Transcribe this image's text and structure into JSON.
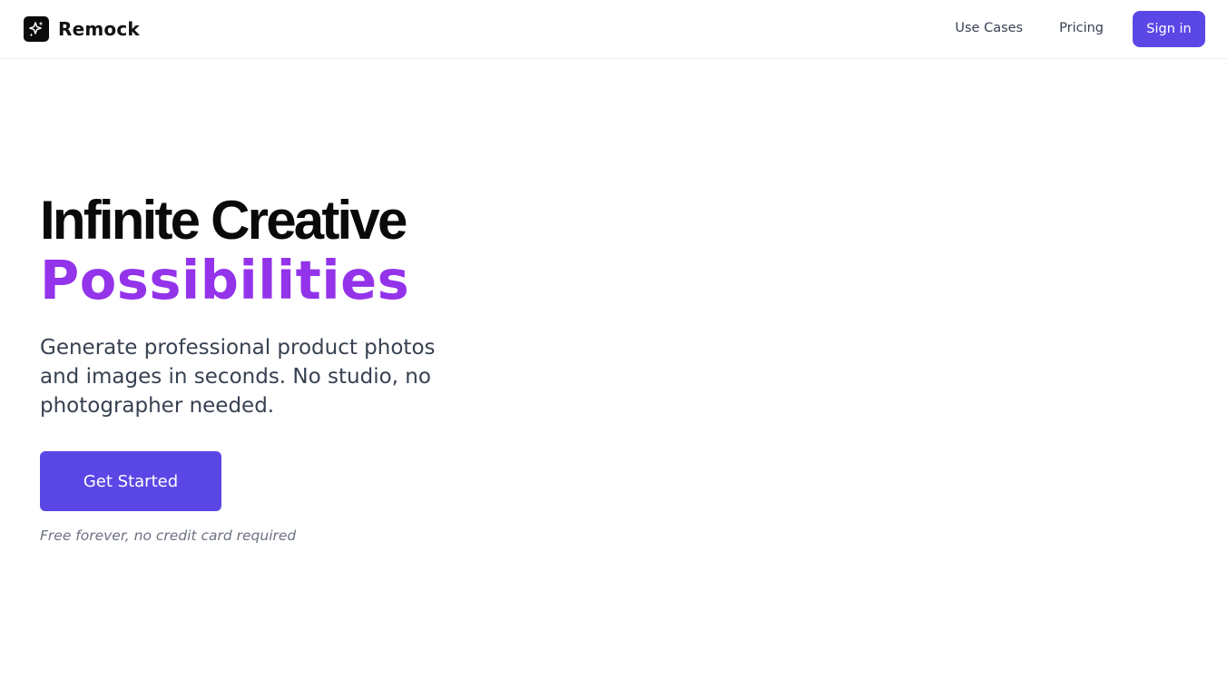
{
  "header": {
    "brand_name": "Remock",
    "brand_icon": "sparkles-icon",
    "nav": {
      "use_cases_label": "Use Cases",
      "pricing_label": "Pricing",
      "sign_in_label": "Sign in"
    }
  },
  "hero": {
    "title_line1": "Infinite Creative",
    "title_line2": "Possibilities",
    "subtitle": "Generate professional product photos and images in seconds. No studio, no photographer needed.",
    "cta_label": "Get Started",
    "cta_note": "Free forever, no credit card required"
  },
  "colors": {
    "accent": "#5b47e5",
    "highlight": "#9333ea",
    "text_primary": "#0a0a0a",
    "text_secondary": "#374151",
    "text_muted": "#6b7280"
  }
}
